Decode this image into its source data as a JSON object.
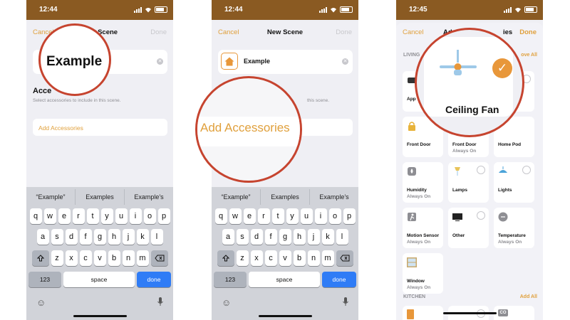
{
  "colors": {
    "accent": "#e0a03c",
    "magnifier_ring": "#c6442f",
    "done_key": "#2f7cf6",
    "status_bar": "#8a5a22"
  },
  "panel1": {
    "time": "12:44",
    "nav": {
      "cancel": "Cancel",
      "title": "New Scene",
      "done": "Done"
    },
    "magnified_text": "Example",
    "accessories_title": "Acce",
    "accessories_sub": "Select accessories to include in this scene.",
    "add_accessories": "Add Accessories",
    "suggestions": [
      "“Example”",
      "Examples",
      "Example’s"
    ],
    "keys_row1": [
      "q",
      "w",
      "e",
      "r",
      "t",
      "y",
      "u",
      "i",
      "o",
      "p"
    ],
    "keys_row2": [
      "a",
      "s",
      "d",
      "f",
      "g",
      "h",
      "j",
      "k",
      "l"
    ],
    "keys_row3": [
      "z",
      "x",
      "c",
      "v",
      "b",
      "n",
      "m"
    ],
    "key_123": "123",
    "key_space": "space",
    "key_done": "done"
  },
  "panel2": {
    "time": "12:44",
    "nav": {
      "cancel": "Cancel",
      "title": "New Scene",
      "done": "Done"
    },
    "name": "Example",
    "accessories_sub_tail": "this scene.",
    "magnified_text": "Add Accessories",
    "suggestions": [
      "“Example”",
      "Examples",
      "Example’s"
    ],
    "keys_row1": [
      "q",
      "w",
      "e",
      "r",
      "t",
      "y",
      "u",
      "i",
      "o",
      "p"
    ],
    "keys_row2": [
      "a",
      "s",
      "d",
      "f",
      "g",
      "h",
      "j",
      "k",
      "l"
    ],
    "keys_row3": [
      "z",
      "x",
      "c",
      "v",
      "b",
      "n",
      "m"
    ],
    "key_123": "123",
    "key_space": "space",
    "key_done": "done"
  },
  "panel3": {
    "time": "12:45",
    "nav": {
      "cancel": "Cancel",
      "title": "Ad",
      "title_tail": "ies",
      "done": "Done"
    },
    "room1": "LIVING",
    "room1_add_all": "ove All",
    "magnified_text": "Ceiling Fan",
    "tiles": [
      {
        "name": "App",
        "state": "",
        "icon": "apple-tv-icon",
        "radio": false
      },
      {
        "name": "",
        "state": "",
        "icon": "",
        "radio": false
      },
      {
        "name": "",
        "state": "",
        "icon": "",
        "radio": true
      },
      {
        "name": "Front Door",
        "state": "",
        "icon": "lock-icon",
        "radio": false
      },
      {
        "name": "Front Door",
        "state": "Always On",
        "icon": "",
        "radio": false
      },
      {
        "name": "Home Pod",
        "state": "",
        "icon": "",
        "radio": false
      },
      {
        "name": "Humidity",
        "state": "Always On",
        "icon": "humidity-icon",
        "radio": false
      },
      {
        "name": "Lamps",
        "state": "",
        "icon": "lamp-icon",
        "radio": true
      },
      {
        "name": "Lights",
        "state": "",
        "icon": "light-icon",
        "radio": true
      },
      {
        "name": "Motion Sensor",
        "state": "Always On",
        "icon": "motion-icon",
        "radio": false
      },
      {
        "name": "Other",
        "state": "",
        "icon": "tv-icon",
        "radio": true
      },
      {
        "name": "Temperature",
        "state": "Always On",
        "icon": "thermometer-icon",
        "radio": false
      },
      {
        "name": "Window",
        "state": "Always On",
        "icon": "window-icon",
        "radio": false
      }
    ],
    "room2": "KITCHEN",
    "room2_add_all": "Add All",
    "co_label": "CO"
  }
}
